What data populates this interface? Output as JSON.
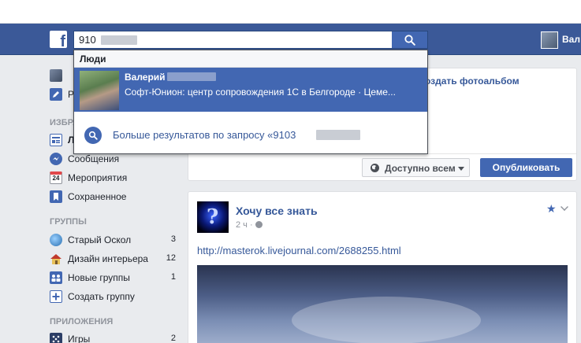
{
  "header": {
    "search_value": "910",
    "user_name": "Вал",
    "search_icon": "search-icon",
    "logo": "facebook-logo-f"
  },
  "dropdown": {
    "section_label": "Люди",
    "result": {
      "name": "Валерий",
      "subtitle": "Софт-Юнион: центр сопровождения 1С в Белгороде · Цеме..."
    },
    "more_label": "Больше результатов по запросу «9103"
  },
  "sidebar": {
    "top_items": [
      {
        "label": "",
        "icon": "profile-avatar-icon"
      },
      {
        "label": "Р",
        "icon": "edit-profile-icon"
      }
    ],
    "favorites_title": "ИЗБРА",
    "favorites": [
      {
        "label": "Л",
        "icon": "news-feed-icon"
      },
      {
        "label": "Сообщения",
        "icon": "messages-icon"
      },
      {
        "label": "Мероприятия",
        "icon": "calendar-icon",
        "icon_text": "24"
      },
      {
        "label": "Сохраненное",
        "icon": "bookmark-icon"
      }
    ],
    "groups_title": "ГРУППЫ",
    "groups": [
      {
        "label": "Старый Оскол",
        "count": "3",
        "icon": "globe-group-icon"
      },
      {
        "label": "Дизайн интерьера",
        "count": "12",
        "icon": "house-group-icon"
      },
      {
        "label": "Новые группы",
        "count": "1",
        "icon": "people-group-icon"
      },
      {
        "label": "Создать группу",
        "count": "",
        "icon": "plus-icon"
      }
    ],
    "apps_title": "ПРИЛОЖЕНИЯ",
    "apps": [
      {
        "label": "Игры",
        "count": "2",
        "icon": "games-icon"
      }
    ]
  },
  "composer": {
    "album_tab": "оздать фотоальбом",
    "privacy_label": "Доступно всем",
    "publish_label": "Опубликовать"
  },
  "post": {
    "author": "Хочу все знать",
    "time": "2 ч ·",
    "link": "http://masterok.livejournal.com/2688255.html"
  },
  "colors": {
    "brand": "#3b5998",
    "accent": "#4267b2",
    "link": "#365899",
    "background": "#e9ebee"
  }
}
